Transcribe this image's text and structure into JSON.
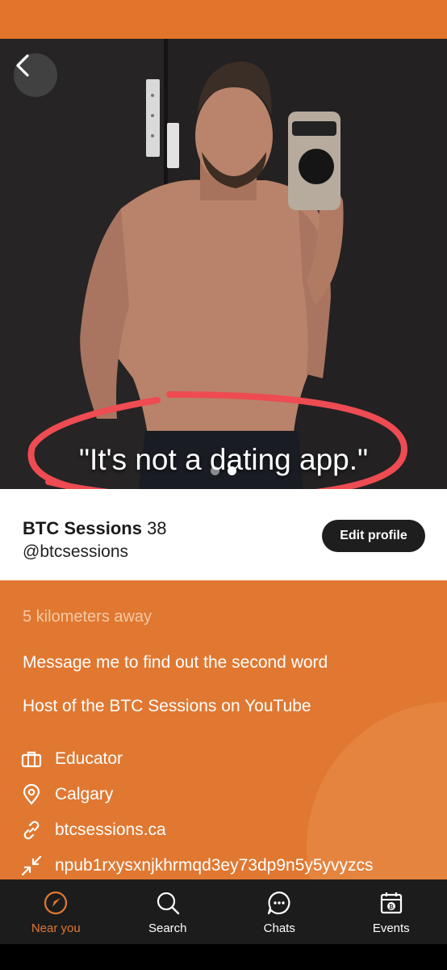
{
  "colors": {
    "accent": "#e07831",
    "status_bar": "#e3742c",
    "nav_bg": "#1c1c1c",
    "button_dark": "#1e1e1e"
  },
  "photo": {
    "caption": "\"It's not a dating app.\"",
    "dots": 2,
    "active_dot": 1,
    "back_icon": "chevron-left-icon"
  },
  "profile": {
    "name": "BTC Sessions",
    "age": "38",
    "handle": "@btcsessions",
    "edit_label": "Edit profile"
  },
  "info": {
    "distance": "5 kilometers away",
    "bio_line_1": "Message me to find out the second word",
    "bio_line_2": "Host of the BTC Sessions on YouTube",
    "occupation": {
      "icon": "briefcase-icon",
      "text": "Educator"
    },
    "location": {
      "icon": "map-pin-icon",
      "text": "Calgary"
    },
    "website": {
      "icon": "link-icon",
      "text": "btcsessions.ca"
    },
    "npub": {
      "icon": "collapse-arrows-icon",
      "text": "npub1rxysxnjkhrmqd3ey73dp9n5y5yvyzcs"
    }
  },
  "nav": [
    {
      "label": "Near you",
      "icon": "compass-icon",
      "active": true
    },
    {
      "label": "Search",
      "icon": "search-icon",
      "active": false
    },
    {
      "label": "Chats",
      "icon": "chat-bubble-icon",
      "active": false
    },
    {
      "label": "Events",
      "icon": "calendar-bitcoin-icon",
      "active": false
    }
  ]
}
